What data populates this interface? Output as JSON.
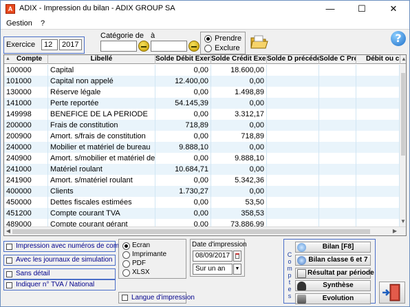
{
  "window": {
    "title": "ADIX - Impression du bilan - ADIX GROUP SA",
    "minimize_glyph": "—",
    "maximize_glyph": "☐",
    "close_glyph": "✕"
  },
  "menu": {
    "items": [
      "Gestion",
      "?"
    ]
  },
  "filters": {
    "exercice_label": "Exercice",
    "exercice_number": "12",
    "exercice_year": "2017",
    "categorie_label": "Catégorie de",
    "a_label": "à",
    "categorie_from": "",
    "categorie_to": "",
    "prendre_label": "Prendre",
    "exclure_label": "Exclure",
    "selected": "Prendre"
  },
  "grid": {
    "columns": [
      "Compte",
      "Libellé",
      "Solde Débit Exercic",
      "Solde Crédit Exercic",
      "Solde D précédent",
      "Solde C Préc",
      "Débit ou crédit"
    ],
    "rows": [
      [
        "100000",
        "Capital",
        "0,00",
        "18.600,00"
      ],
      [
        "101000",
        "Capital non appelé",
        "12.400,00",
        "0,00"
      ],
      [
        "130000",
        "Réserve légale",
        "0,00",
        "1.498,89"
      ],
      [
        "141000",
        "Perte reportée",
        "54.145,39",
        "0,00"
      ],
      [
        "149998",
        "BENEFICE DE LA PERIODE",
        "0,00",
        "3.312,17"
      ],
      [
        "200000",
        "Frais de constitution",
        "718,89",
        "0,00"
      ],
      [
        "200900",
        "Amort. s/frais de constitution",
        "0,00",
        "718,89"
      ],
      [
        "240000",
        "Mobilier et matériel de bureau",
        "9.888,10",
        "0,00"
      ],
      [
        "240900",
        "Amort. s/mobilier et matériel de bu",
        "0,00",
        "9.888,10"
      ],
      [
        "241000",
        "Matériel roulant",
        "10.684,71",
        "0,00"
      ],
      [
        "241900",
        "Amort. s/matériel roulant",
        "0,00",
        "5.342,36"
      ],
      [
        "400000",
        "Clients",
        "1.730,27",
        "0,00"
      ],
      [
        "450000",
        "Dettes fiscales estimées",
        "0,00",
        "53,50"
      ],
      [
        "451200",
        "Compte courant TVA",
        "0,00",
        "358,53"
      ],
      [
        "489000",
        "Compte courant gérant",
        "0,00",
        "73.886,99"
      ]
    ]
  },
  "options": {
    "checkboxes": [
      "Impression avec numéros de comptes",
      "Avec les journaux de simulation",
      "Sans détail",
      "Indiquer n° TVA / National"
    ],
    "formats": [
      "Ecran",
      "Imprimante",
      "PDF",
      "XLSX"
    ],
    "selected_format": "Ecran",
    "langue_label": "Langue d'impression"
  },
  "date": {
    "label": "Date d'impression",
    "value": "08/09/2017",
    "period_value": "Sur un an"
  },
  "comptes_panel": {
    "vertical_label": "Comptes",
    "buttons": [
      "Bilan  [F8]",
      "Bilan classe 6 et 7",
      "Résultat par période",
      "Synthèse",
      "Evolution"
    ]
  },
  "icons": {
    "app": "adix-logo-icon",
    "help": "help-icon",
    "folder": "open-folder-icon",
    "exit": "exit-door-icon"
  },
  "colors": {
    "panel_border": "#4a6ec8",
    "row_alt": "#e9f4fb",
    "option_text": "#00008b"
  }
}
